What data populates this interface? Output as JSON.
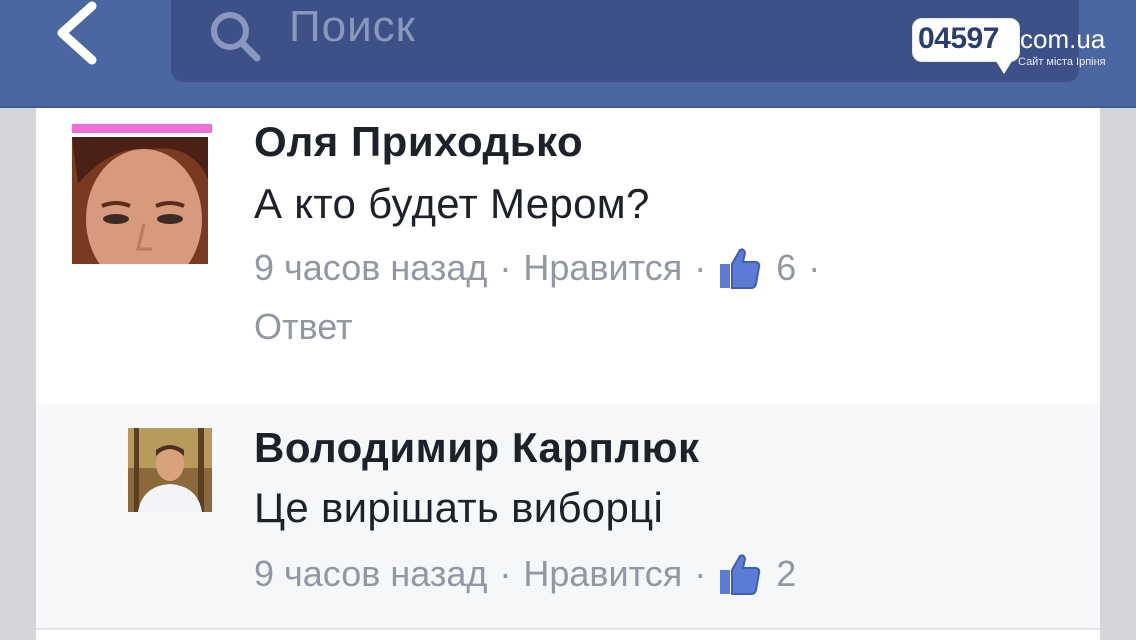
{
  "header": {
    "search_placeholder": "Поиск",
    "colors": {
      "bar": "#4b67a1",
      "search_bg": "#3d5188"
    }
  },
  "watermark": {
    "number": "04597",
    "domain": "com.ua",
    "subtitle": "Сайт міста Ірпіня"
  },
  "comments": [
    {
      "author": "Оля Приходько",
      "text": "А кто будет Мером?",
      "time": "9 часов назад",
      "like_label": "Нравится",
      "like_count": "6",
      "reply_label": "Ответ"
    },
    {
      "author": "Володимир Карплюк",
      "text": "Це вирішать виборці",
      "time": "9 часов назад",
      "like_label": "Нравится",
      "like_count": "2"
    }
  ],
  "icons": [
    "back-chevron-icon",
    "search-icon",
    "thumbs-up-icon"
  ]
}
